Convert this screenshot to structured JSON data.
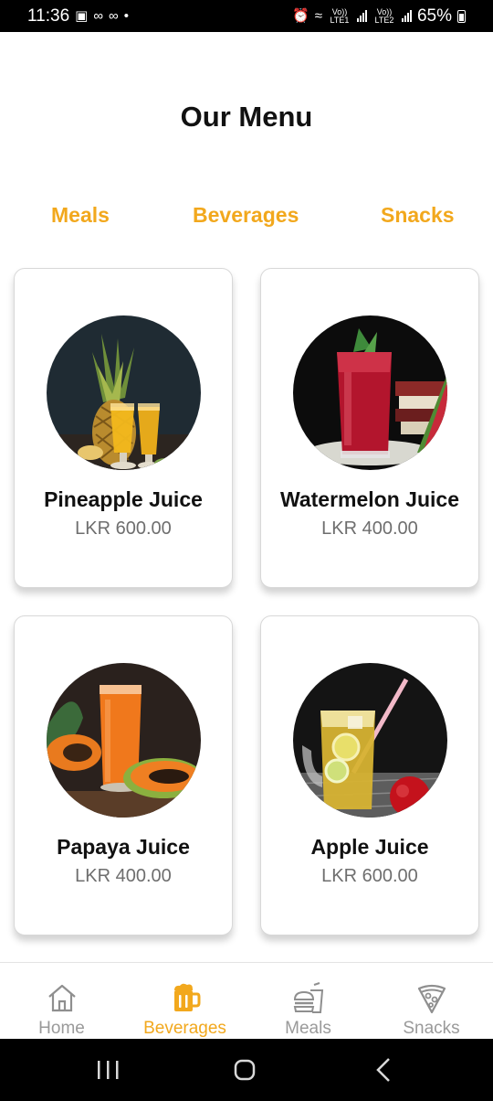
{
  "status_bar": {
    "time": "11:36",
    "battery": "65%",
    "sim1_label": "Vo)) LTE1",
    "sim2_label": "Vo)) LTE2"
  },
  "header": {
    "title": "Our Menu"
  },
  "categories": {
    "meals": "Meals",
    "beverages": "Beverages",
    "snacks": "Snacks"
  },
  "menu_items": [
    {
      "name": "Pineapple Juice",
      "price": "LKR 600.00",
      "image": "pineapple-juice-photo"
    },
    {
      "name": "Watermelon Juice",
      "price": "LKR 400.00",
      "image": "watermelon-juice-photo"
    },
    {
      "name": "Papaya Juice",
      "price": "LKR 400.00",
      "image": "papaya-juice-photo"
    },
    {
      "name": "Apple Juice",
      "price": "LKR 600.00",
      "image": "apple-juice-photo"
    }
  ],
  "bottom_nav": {
    "active": "Beverages",
    "items": [
      {
        "label": "Home",
        "icon": "home-icon"
      },
      {
        "label": "Beverages",
        "icon": "beer-mug-icon"
      },
      {
        "label": "Meals",
        "icon": "burger-drink-icon"
      },
      {
        "label": "Snacks",
        "icon": "pizza-slice-icon"
      }
    ]
  },
  "colors": {
    "accent": "#f2a81d",
    "inactive": "#9a9a9a",
    "price": "#6e6e6e",
    "text": "#111111"
  }
}
